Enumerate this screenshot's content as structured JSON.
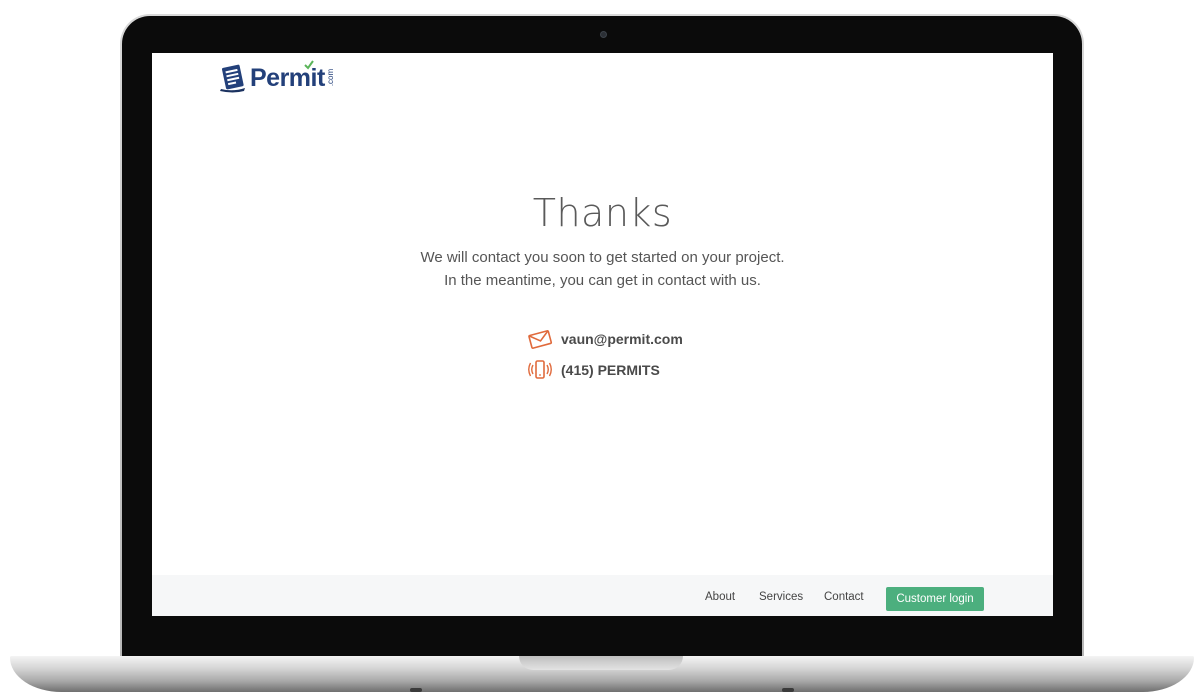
{
  "brand": {
    "name": "Permit",
    "suffix": ".com",
    "colors": {
      "primary": "#23407a",
      "check": "#5bb55a",
      "accent": "#e06a3c",
      "button": "#4caf7e"
    }
  },
  "thanks": {
    "title": "Thanks",
    "line1": "We will contact you soon to get started on your project.",
    "line2": "In the meantime, you can get in contact with us."
  },
  "contact": {
    "email": {
      "icon": "envelope-icon",
      "value": "vaun@permit.com"
    },
    "phone": {
      "icon": "vibrating-phone-icon",
      "value": "(415) PERMITS"
    }
  },
  "footer": {
    "nav": [
      "About",
      "Services",
      "Contact"
    ],
    "login_label": "Customer login"
  }
}
